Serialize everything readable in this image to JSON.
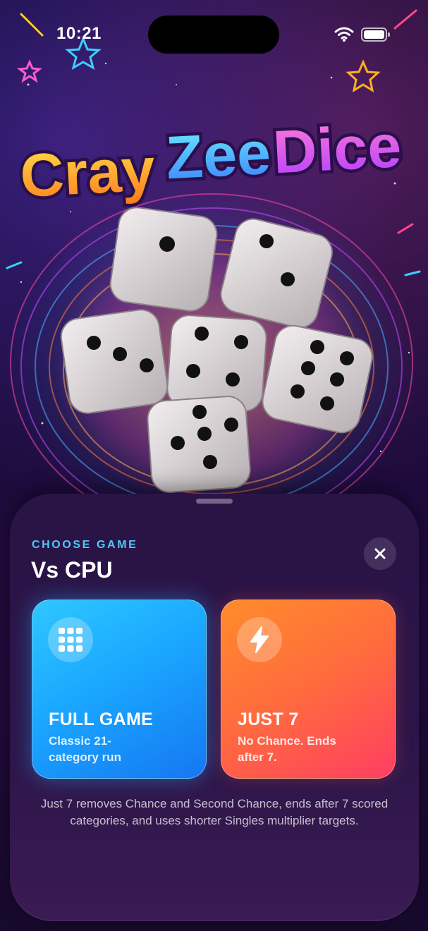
{
  "status_bar": {
    "time": "10:21"
  },
  "brand": {
    "logo_part1": "Cray",
    "logo_part2": "Zee",
    "logo_part3": "Dice"
  },
  "sheet": {
    "eyebrow": "CHOOSE GAME",
    "title": "Vs CPU",
    "cards": [
      {
        "title": "FULL GAME",
        "subtitle": "Classic 21-category run",
        "icon": "grid-icon"
      },
      {
        "title": "JUST 7",
        "subtitle": "No Chance. Ends after 7.",
        "icon": "lightning-icon"
      }
    ],
    "footnote": "Just 7 removes Chance and Second Chance, ends after 7 scored categories, and uses shorter Singles multiplier targets."
  },
  "colors": {
    "eyebrow": "#52c8f7",
    "full_game": "#1aa7ff",
    "just7": "#ff6a3e",
    "sheet": "#2a1446"
  }
}
